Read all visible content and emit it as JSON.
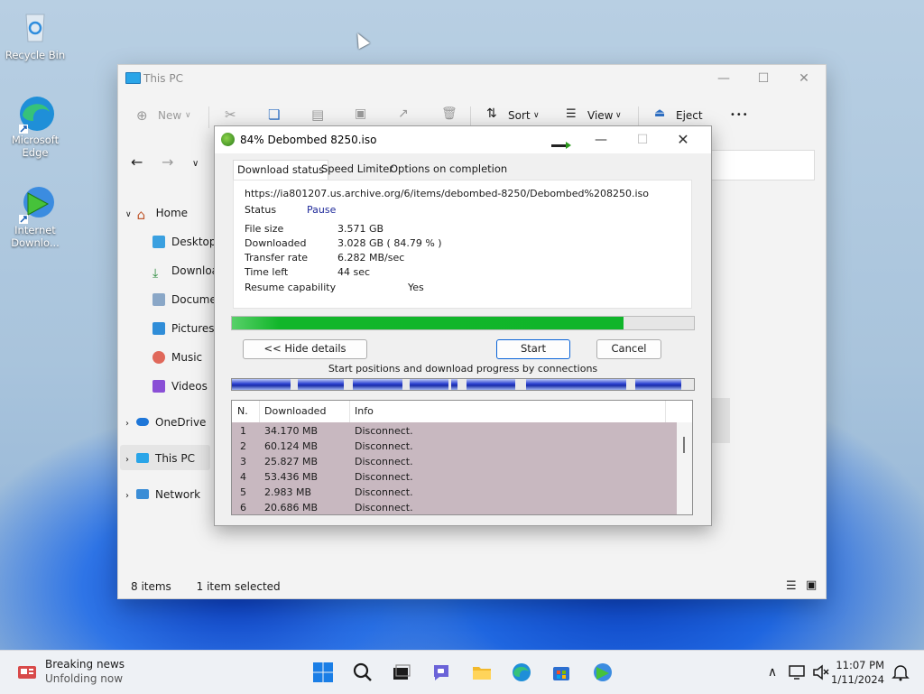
{
  "desktop": {
    "icons": [
      {
        "label": "Recycle Bin"
      },
      {
        "label_line1": "Microsoft",
        "label_line2": "Edge"
      },
      {
        "label_line1": "Internet",
        "label_line2": "Downlo..."
      }
    ]
  },
  "explorer": {
    "title": "This PC",
    "toolbar": {
      "new": "New",
      "sort": "Sort",
      "view": "View",
      "eject": "Eject",
      "more": "•••"
    },
    "sidebar": [
      {
        "label": "Home"
      },
      {
        "label": "Desktop"
      },
      {
        "label": "Downloa"
      },
      {
        "label": "Documen"
      },
      {
        "label": "Pictures"
      },
      {
        "label": "Music"
      },
      {
        "label": "Videos"
      },
      {
        "label": "OneDrive"
      },
      {
        "label": "This PC"
      },
      {
        "label": "Network"
      }
    ],
    "status": {
      "items": "8 items",
      "selected": "1 item selected"
    }
  },
  "dialog": {
    "title": "84% Debombed 8250.iso",
    "tabs": [
      "Download status",
      "Speed Limiter",
      "Options on completion"
    ],
    "url": "https://ia801207.us.archive.org/6/items/debombed-8250/Debombed%208250.iso",
    "status_label": "Status",
    "status_value": "Pause",
    "fields": [
      {
        "label": "File size",
        "value": "3.571  GB"
      },
      {
        "label": "Downloaded",
        "value": "3.028  GB  ( 84.79 % )"
      },
      {
        "label": "Transfer rate",
        "value": "6.282  MB/sec"
      },
      {
        "label": "Time left",
        "value": "44 sec"
      },
      {
        "label": "Resume capability",
        "value": "Yes"
      }
    ],
    "progress_fraction": 0.8479,
    "buttons": {
      "hide": "<< Hide details",
      "start": "Start",
      "cancel": "Cancel"
    },
    "connections_caption": "Start positions and download progress by connections",
    "table": {
      "headers": [
        "N.",
        "Downloaded",
        "Info"
      ],
      "rows": [
        {
          "n": "1",
          "downloaded": "34.170  MB",
          "info": "Disconnect."
        },
        {
          "n": "2",
          "downloaded": "60.124  MB",
          "info": "Disconnect."
        },
        {
          "n": "3",
          "downloaded": "25.827  MB",
          "info": "Disconnect."
        },
        {
          "n": "4",
          "downloaded": "53.436  MB",
          "info": "Disconnect."
        },
        {
          "n": "5",
          "downloaded": "2.983  MB",
          "info": "Disconnect."
        },
        {
          "n": "6",
          "downloaded": "20.686  MB",
          "info": "Disconnect."
        }
      ]
    }
  },
  "taskbar": {
    "news_title": "Breaking news",
    "news_subtitle": "Unfolding now",
    "time": "11:07 PM",
    "date": "1/11/2024"
  }
}
